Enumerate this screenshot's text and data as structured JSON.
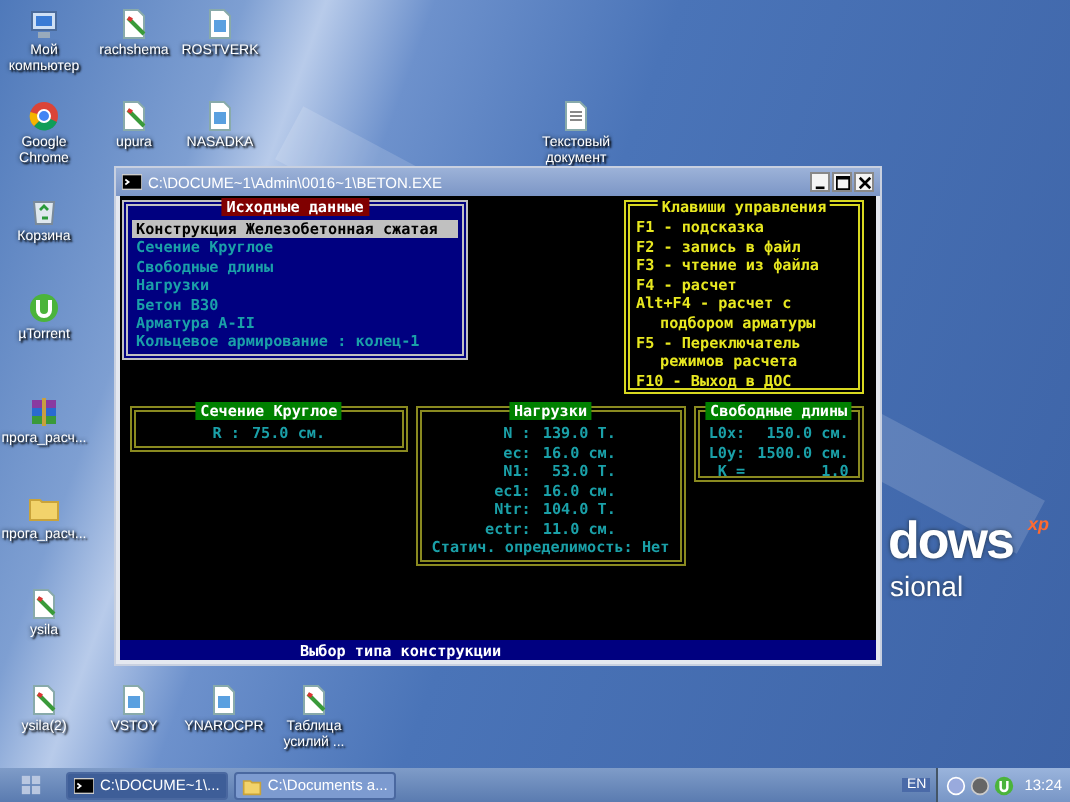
{
  "desktop": {
    "icons": [
      {
        "label": "Мой компьютер",
        "kind": "computer"
      },
      {
        "label": "rachshema",
        "kind": "shortcut"
      },
      {
        "label": "ROSTVERK",
        "kind": "document"
      },
      {
        "label": "Google Chrome",
        "kind": "chrome"
      },
      {
        "label": "upura",
        "kind": "shortcut"
      },
      {
        "label": "NASADKA",
        "kind": "document"
      },
      {
        "label": "Текстовый документ",
        "kind": "text"
      },
      {
        "label": "Корзина",
        "kind": "recycle"
      },
      {
        "label": "µTorrent",
        "kind": "torrent"
      },
      {
        "label": "прога_расч...",
        "kind": "archive"
      },
      {
        "label": "прога_расч...",
        "kind": "folder"
      },
      {
        "label": "ysila",
        "kind": "shortcut"
      },
      {
        "label": "ysila(2)",
        "kind": "shortcut"
      },
      {
        "label": "VSTOY",
        "kind": "document"
      },
      {
        "label": "YNAROCPR",
        "kind": "document"
      },
      {
        "label": "Таблица усилий ...",
        "kind": "shortcut"
      }
    ],
    "wallpaper_text": [
      "dows",
      "xp",
      "sional"
    ]
  },
  "console_window": {
    "title": "C:\\DOCUME~1\\Admin\\0016~1\\BETON.EXE",
    "menu_panel": {
      "title": "Исходные данные",
      "items": [
        {
          "label": "Конструкция Железобетонная сжатая",
          "selected": true
        },
        {
          "label": "Сечение Круглое",
          "selected": false
        },
        {
          "label": "Свободные длины",
          "selected": false
        },
        {
          "label": "Нагрузки",
          "selected": false
        },
        {
          "label": "Бетон B30",
          "selected": false
        },
        {
          "label": "Арматура A-II",
          "selected": false
        },
        {
          "label": "Кольцевое армирование : колец-1",
          "selected": false
        }
      ]
    },
    "keys_panel": {
      "title": "Клавиши управления",
      "lines": [
        {
          "text": "F1 - подсказка",
          "continuation": false
        },
        {
          "text": "F2 - запись в файл",
          "continuation": false
        },
        {
          "text": "F3 - чтение из файла",
          "continuation": false
        },
        {
          "text": "F4 - расчет",
          "continuation": false
        },
        {
          "text": "Alt+F4 - расчет с",
          "continuation": false
        },
        {
          "text": "подбором арматуры",
          "continuation": true
        },
        {
          "text": "F5 - Переключатель",
          "continuation": false
        },
        {
          "text": "режимов расчета",
          "continuation": true
        },
        {
          "text": "F10 - Выход в ДОС",
          "continuation": false
        }
      ]
    },
    "section_box": {
      "title": "Сечение Круглое",
      "rows": [
        {
          "label": "R :",
          "value": "75.0 см."
        }
      ]
    },
    "loads_box": {
      "title": "Нагрузки",
      "rows": [
        {
          "label": "N :",
          "value": "139.0 Т."
        },
        {
          "label": "ec:",
          "value": "16.0 см."
        },
        {
          "label": "N1:",
          "value": "53.0 Т."
        },
        {
          "label": "ec1:",
          "value": "16.0 см."
        },
        {
          "label": "Ntr:",
          "value": "104.0 Т."
        },
        {
          "label": "ectr:",
          "value": "11.0 см."
        }
      ],
      "footer": "Статич. определимость: Нет"
    },
    "lengths_box": {
      "title": "Свободные длины",
      "rows": [
        {
          "label": "L0x:",
          "value": "150.0 см."
        },
        {
          "label": "L0y:",
          "value": "1500.0 см."
        },
        {
          "label": "K =",
          "value": "1.0"
        }
      ]
    },
    "status_text": "Выбор типа конструкции"
  },
  "taskbar": {
    "tasks": [
      {
        "label": "C:\\DOCUME~1\\...",
        "kind": "console",
        "selected": true
      },
      {
        "label": "C:\\Documents a...",
        "kind": "folder",
        "selected": false
      }
    ],
    "language": "EN",
    "clock": "13:24"
  }
}
